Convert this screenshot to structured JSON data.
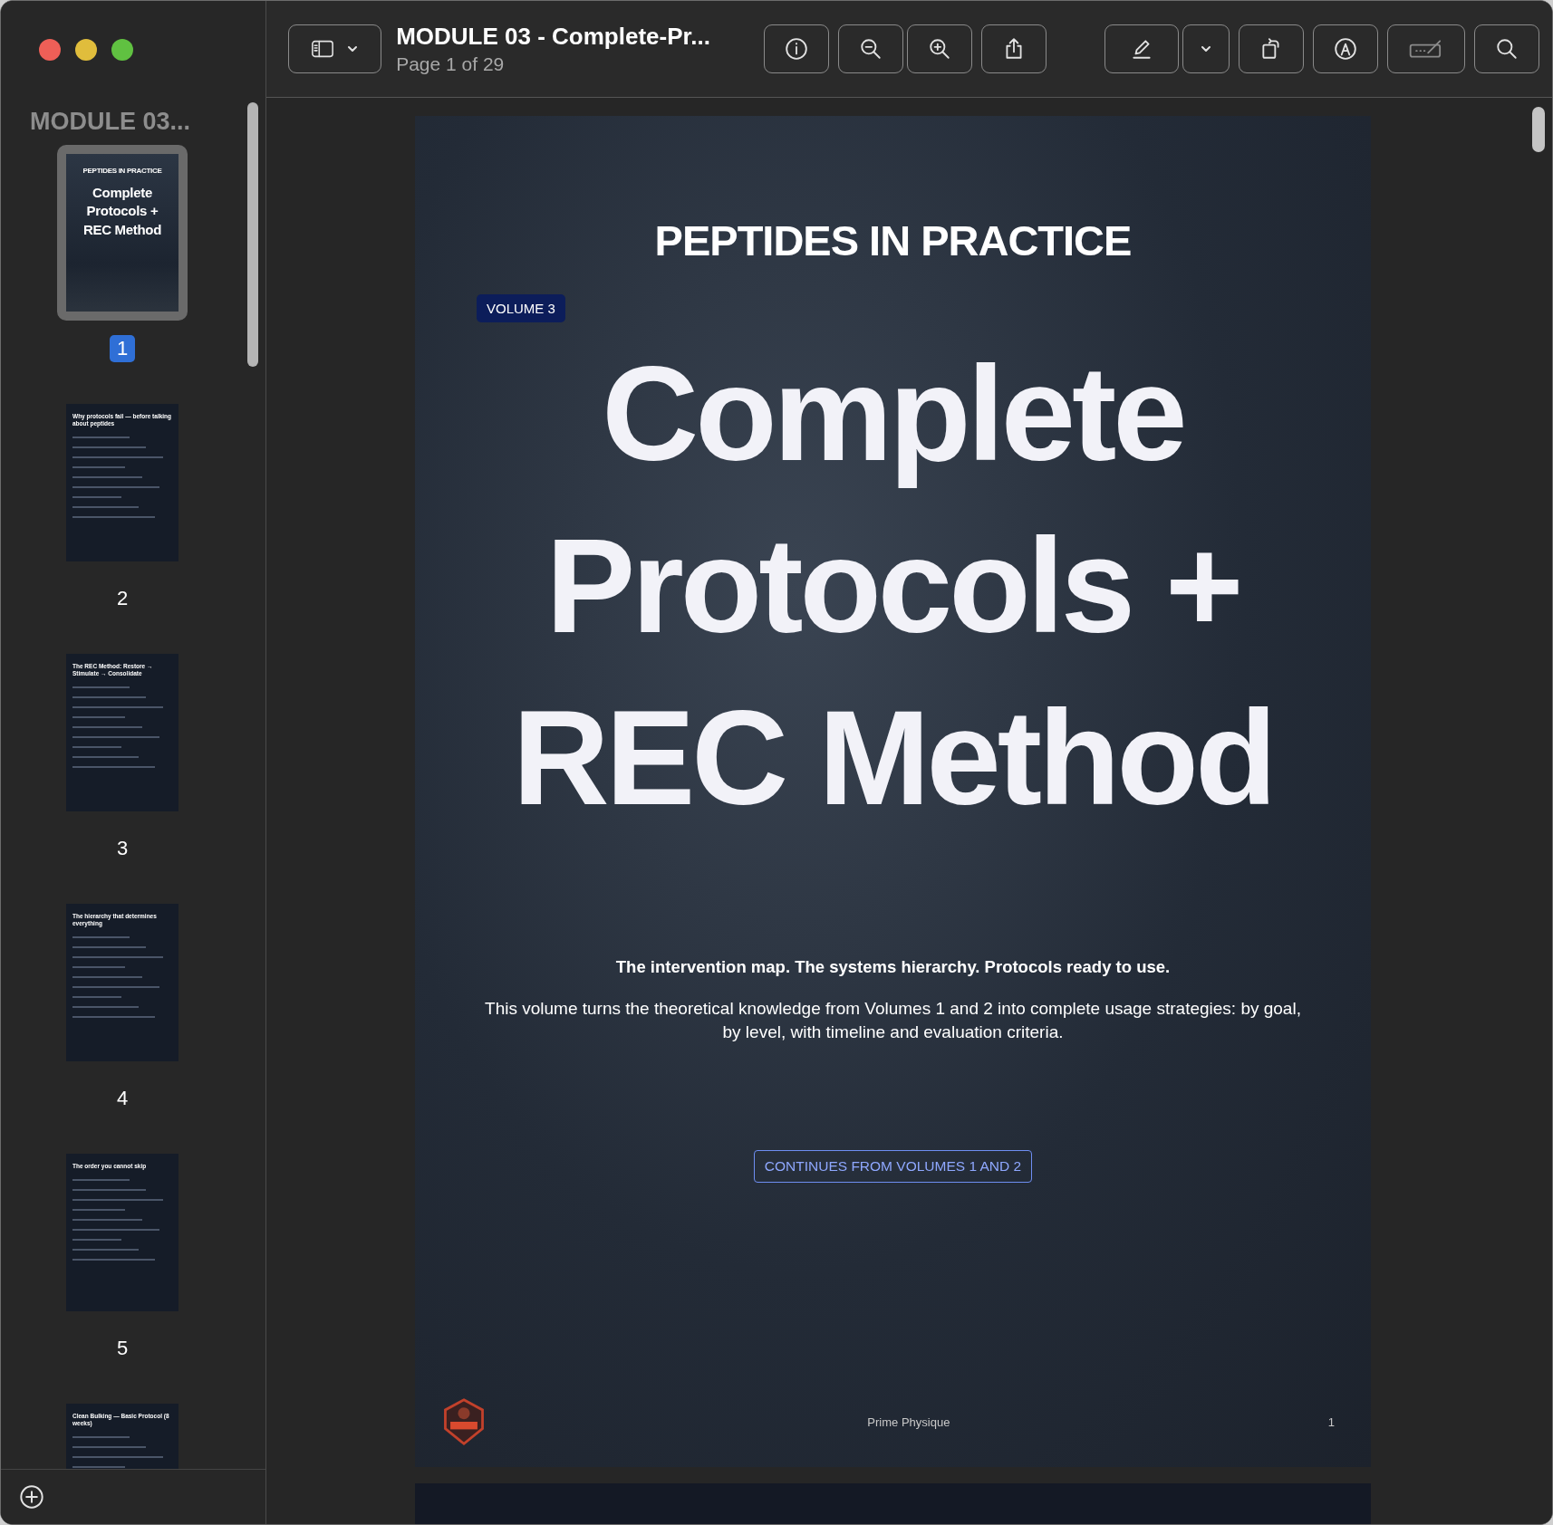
{
  "window": {
    "title": "MODULE 03 - Complete-Pr...",
    "subtitle": "Page 1 of 29"
  },
  "sidebar": {
    "title": "MODULE 03...",
    "pages": [
      {
        "label": "1",
        "selected": true,
        "kind": "cover",
        "heading": "PEPTIDES IN PRACTICE",
        "title": "Complete Protocols + REC Method"
      },
      {
        "label": "2",
        "selected": false,
        "kind": "content",
        "title": "Why protocols fail — before talking about peptides"
      },
      {
        "label": "3",
        "selected": false,
        "kind": "content",
        "title": "The REC Method: Restore → Stimulate → Consolidate"
      },
      {
        "label": "4",
        "selected": false,
        "kind": "content",
        "title": "The hierarchy that determines everything"
      },
      {
        "label": "5",
        "selected": false,
        "kind": "content",
        "title": "The order you cannot skip"
      },
      {
        "selected": false,
        "kind": "content",
        "title": "Clean Bulking — Basic Protocol (8 weeks)"
      }
    ]
  },
  "page": {
    "heading": "PEPTIDES IN PRACTICE",
    "badge": "VOLUME 3",
    "title_lines": [
      "Complete",
      "Protocols +",
      "REC Method"
    ],
    "tagline": "The intervention map. The systems hierarchy. Protocols ready to use.",
    "description": "This volume turns the theoretical knowledge from Volumes 1 and 2 into complete usage strategies: by goal, by level, with timeline and evaluation criteria.",
    "button": "CONTINUES FROM VOLUMES 1 AND 2",
    "footer": {
      "brand": "Prime Physique",
      "page_number": "1"
    }
  }
}
